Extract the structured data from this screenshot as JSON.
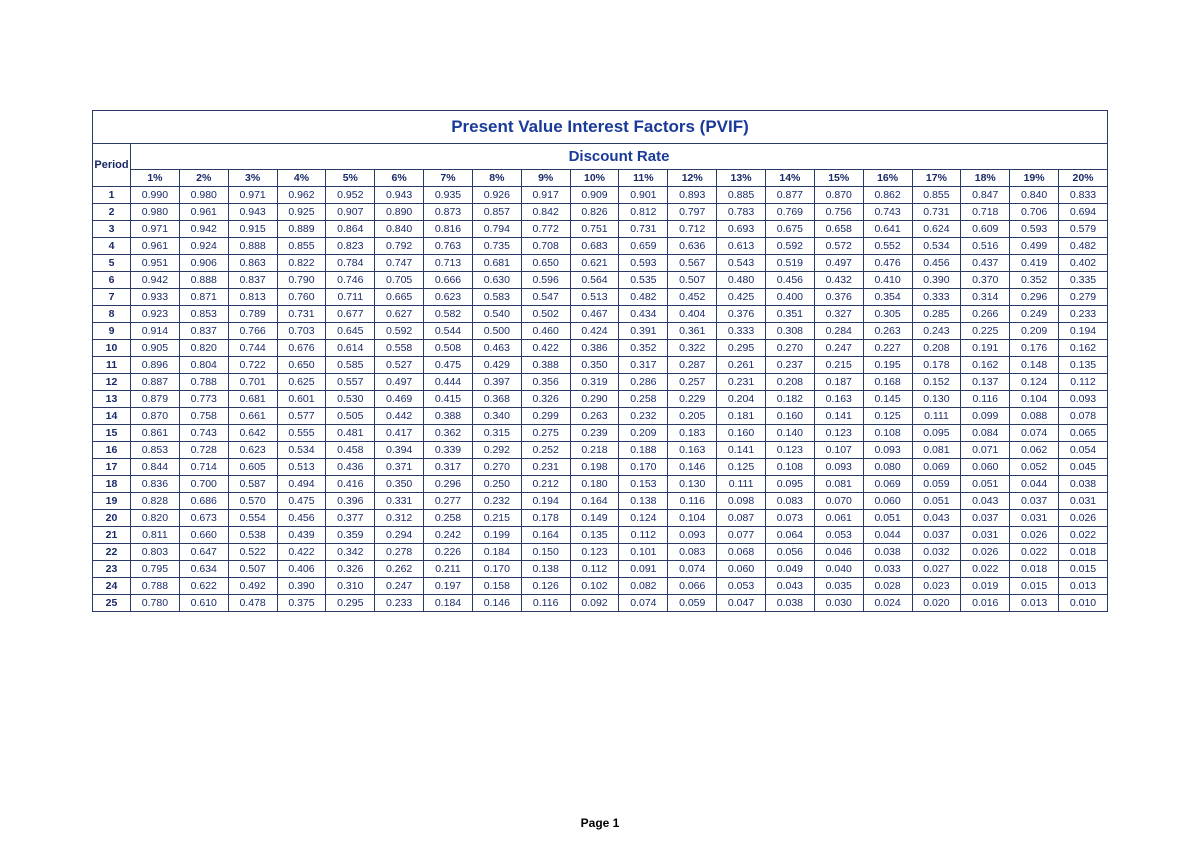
{
  "chart_data": {
    "type": "table",
    "title": "Present Value Interest Factors (PVIF)",
    "subtitle": "Discount Rate",
    "period_label": "Period",
    "footer": "Page 1",
    "rates": [
      "1%",
      "2%",
      "3%",
      "4%",
      "5%",
      "6%",
      "7%",
      "8%",
      "9%",
      "10%",
      "11%",
      "12%",
      "13%",
      "14%",
      "15%",
      "16%",
      "17%",
      "18%",
      "19%",
      "20%"
    ],
    "periods": [
      "1",
      "2",
      "3",
      "4",
      "5",
      "6",
      "7",
      "8",
      "9",
      "10",
      "11",
      "12",
      "13",
      "14",
      "15",
      "16",
      "17",
      "18",
      "19",
      "20",
      "21",
      "22",
      "23",
      "24",
      "25"
    ],
    "values": [
      [
        "0.990",
        "0.980",
        "0.971",
        "0.962",
        "0.952",
        "0.943",
        "0.935",
        "0.926",
        "0.917",
        "0.909",
        "0.901",
        "0.893",
        "0.885",
        "0.877",
        "0.870",
        "0.862",
        "0.855",
        "0.847",
        "0.840",
        "0.833"
      ],
      [
        "0.980",
        "0.961",
        "0.943",
        "0.925",
        "0.907",
        "0.890",
        "0.873",
        "0.857",
        "0.842",
        "0.826",
        "0.812",
        "0.797",
        "0.783",
        "0.769",
        "0.756",
        "0.743",
        "0.731",
        "0.718",
        "0.706",
        "0.694"
      ],
      [
        "0.971",
        "0.942",
        "0.915",
        "0.889",
        "0.864",
        "0.840",
        "0.816",
        "0.794",
        "0.772",
        "0.751",
        "0.731",
        "0.712",
        "0.693",
        "0.675",
        "0.658",
        "0.641",
        "0.624",
        "0.609",
        "0.593",
        "0.579"
      ],
      [
        "0.961",
        "0.924",
        "0.888",
        "0.855",
        "0.823",
        "0.792",
        "0.763",
        "0.735",
        "0.708",
        "0.683",
        "0.659",
        "0.636",
        "0.613",
        "0.592",
        "0.572",
        "0.552",
        "0.534",
        "0.516",
        "0.499",
        "0.482"
      ],
      [
        "0.951",
        "0.906",
        "0.863",
        "0.822",
        "0.784",
        "0.747",
        "0.713",
        "0.681",
        "0.650",
        "0.621",
        "0.593",
        "0.567",
        "0.543",
        "0.519",
        "0.497",
        "0.476",
        "0.456",
        "0.437",
        "0.419",
        "0.402"
      ],
      [
        "0.942",
        "0.888",
        "0.837",
        "0.790",
        "0.746",
        "0.705",
        "0.666",
        "0.630",
        "0.596",
        "0.564",
        "0.535",
        "0.507",
        "0.480",
        "0.456",
        "0.432",
        "0.410",
        "0.390",
        "0.370",
        "0.352",
        "0.335"
      ],
      [
        "0.933",
        "0.871",
        "0.813",
        "0.760",
        "0.711",
        "0.665",
        "0.623",
        "0.583",
        "0.547",
        "0.513",
        "0.482",
        "0.452",
        "0.425",
        "0.400",
        "0.376",
        "0.354",
        "0.333",
        "0.314",
        "0.296",
        "0.279"
      ],
      [
        "0.923",
        "0.853",
        "0.789",
        "0.731",
        "0.677",
        "0.627",
        "0.582",
        "0.540",
        "0.502",
        "0.467",
        "0.434",
        "0.404",
        "0.376",
        "0.351",
        "0.327",
        "0.305",
        "0.285",
        "0.266",
        "0.249",
        "0.233"
      ],
      [
        "0.914",
        "0.837",
        "0.766",
        "0.703",
        "0.645",
        "0.592",
        "0.544",
        "0.500",
        "0.460",
        "0.424",
        "0.391",
        "0.361",
        "0.333",
        "0.308",
        "0.284",
        "0.263",
        "0.243",
        "0.225",
        "0.209",
        "0.194"
      ],
      [
        "0.905",
        "0.820",
        "0.744",
        "0.676",
        "0.614",
        "0.558",
        "0.508",
        "0.463",
        "0.422",
        "0.386",
        "0.352",
        "0.322",
        "0.295",
        "0.270",
        "0.247",
        "0.227",
        "0.208",
        "0.191",
        "0.176",
        "0.162"
      ],
      [
        "0.896",
        "0.804",
        "0.722",
        "0.650",
        "0.585",
        "0.527",
        "0.475",
        "0.429",
        "0.388",
        "0.350",
        "0.317",
        "0.287",
        "0.261",
        "0.237",
        "0.215",
        "0.195",
        "0.178",
        "0.162",
        "0.148",
        "0.135"
      ],
      [
        "0.887",
        "0.788",
        "0.701",
        "0.625",
        "0.557",
        "0.497",
        "0.444",
        "0.397",
        "0.356",
        "0.319",
        "0.286",
        "0.257",
        "0.231",
        "0.208",
        "0.187",
        "0.168",
        "0.152",
        "0.137",
        "0.124",
        "0.112"
      ],
      [
        "0.879",
        "0.773",
        "0.681",
        "0.601",
        "0.530",
        "0.469",
        "0.415",
        "0.368",
        "0.326",
        "0.290",
        "0.258",
        "0.229",
        "0.204",
        "0.182",
        "0.163",
        "0.145",
        "0.130",
        "0.116",
        "0.104",
        "0.093"
      ],
      [
        "0.870",
        "0.758",
        "0.661",
        "0.577",
        "0.505",
        "0.442",
        "0.388",
        "0.340",
        "0.299",
        "0.263",
        "0.232",
        "0.205",
        "0.181",
        "0.160",
        "0.141",
        "0.125",
        "0.111",
        "0.099",
        "0.088",
        "0.078"
      ],
      [
        "0.861",
        "0.743",
        "0.642",
        "0.555",
        "0.481",
        "0.417",
        "0.362",
        "0.315",
        "0.275",
        "0.239",
        "0.209",
        "0.183",
        "0.160",
        "0.140",
        "0.123",
        "0.108",
        "0.095",
        "0.084",
        "0.074",
        "0.065"
      ],
      [
        "0.853",
        "0.728",
        "0.623",
        "0.534",
        "0.458",
        "0.394",
        "0.339",
        "0.292",
        "0.252",
        "0.218",
        "0.188",
        "0.163",
        "0.141",
        "0.123",
        "0.107",
        "0.093",
        "0.081",
        "0.071",
        "0.062",
        "0.054"
      ],
      [
        "0.844",
        "0.714",
        "0.605",
        "0.513",
        "0.436",
        "0.371",
        "0.317",
        "0.270",
        "0.231",
        "0.198",
        "0.170",
        "0.146",
        "0.125",
        "0.108",
        "0.093",
        "0.080",
        "0.069",
        "0.060",
        "0.052",
        "0.045"
      ],
      [
        "0.836",
        "0.700",
        "0.587",
        "0.494",
        "0.416",
        "0.350",
        "0.296",
        "0.250",
        "0.212",
        "0.180",
        "0.153",
        "0.130",
        "0.111",
        "0.095",
        "0.081",
        "0.069",
        "0.059",
        "0.051",
        "0.044",
        "0.038"
      ],
      [
        "0.828",
        "0.686",
        "0.570",
        "0.475",
        "0.396",
        "0.331",
        "0.277",
        "0.232",
        "0.194",
        "0.164",
        "0.138",
        "0.116",
        "0.098",
        "0.083",
        "0.070",
        "0.060",
        "0.051",
        "0.043",
        "0.037",
        "0.031"
      ],
      [
        "0.820",
        "0.673",
        "0.554",
        "0.456",
        "0.377",
        "0.312",
        "0.258",
        "0.215",
        "0.178",
        "0.149",
        "0.124",
        "0.104",
        "0.087",
        "0.073",
        "0.061",
        "0.051",
        "0.043",
        "0.037",
        "0.031",
        "0.026"
      ],
      [
        "0.811",
        "0.660",
        "0.538",
        "0.439",
        "0.359",
        "0.294",
        "0.242",
        "0.199",
        "0.164",
        "0.135",
        "0.112",
        "0.093",
        "0.077",
        "0.064",
        "0.053",
        "0.044",
        "0.037",
        "0.031",
        "0.026",
        "0.022"
      ],
      [
        "0.803",
        "0.647",
        "0.522",
        "0.422",
        "0.342",
        "0.278",
        "0.226",
        "0.184",
        "0.150",
        "0.123",
        "0.101",
        "0.083",
        "0.068",
        "0.056",
        "0.046",
        "0.038",
        "0.032",
        "0.026",
        "0.022",
        "0.018"
      ],
      [
        "0.795",
        "0.634",
        "0.507",
        "0.406",
        "0.326",
        "0.262",
        "0.211",
        "0.170",
        "0.138",
        "0.112",
        "0.091",
        "0.074",
        "0.060",
        "0.049",
        "0.040",
        "0.033",
        "0.027",
        "0.022",
        "0.018",
        "0.015"
      ],
      [
        "0.788",
        "0.622",
        "0.492",
        "0.390",
        "0.310",
        "0.247",
        "0.197",
        "0.158",
        "0.126",
        "0.102",
        "0.082",
        "0.066",
        "0.053",
        "0.043",
        "0.035",
        "0.028",
        "0.023",
        "0.019",
        "0.015",
        "0.013"
      ],
      [
        "0.780",
        "0.610",
        "0.478",
        "0.375",
        "0.295",
        "0.233",
        "0.184",
        "0.146",
        "0.116",
        "0.092",
        "0.074",
        "0.059",
        "0.047",
        "0.038",
        "0.030",
        "0.024",
        "0.020",
        "0.016",
        "0.013",
        "0.010"
      ]
    ]
  }
}
